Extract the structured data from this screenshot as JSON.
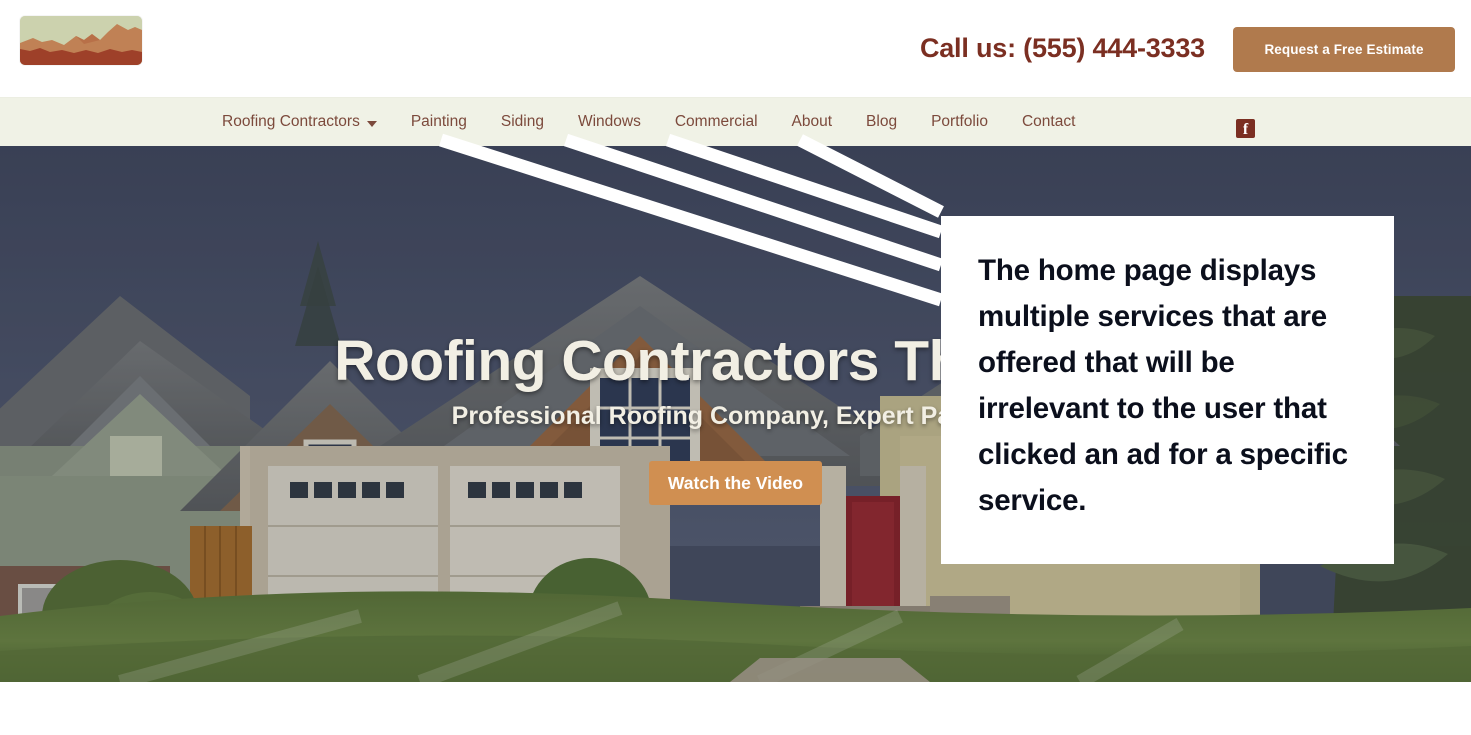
{
  "header": {
    "logo_alt": "mountain-landscape-logo",
    "phone_text": "Call us: (555) 444-3333",
    "estimate_button": "Request a Free Estimate"
  },
  "nav": {
    "items": [
      {
        "label": "Roofing Contractors",
        "has_dropdown": true
      },
      {
        "label": "Painting",
        "has_dropdown": false
      },
      {
        "label": "Siding",
        "has_dropdown": false
      },
      {
        "label": "Windows",
        "has_dropdown": false
      },
      {
        "label": "Commercial",
        "has_dropdown": false
      },
      {
        "label": "About",
        "has_dropdown": false
      },
      {
        "label": "Blog",
        "has_dropdown": false
      },
      {
        "label": "Portfolio",
        "has_dropdown": false
      },
      {
        "label": "Contact",
        "has_dropdown": false
      }
    ],
    "social": {
      "icon": "facebook-icon",
      "glyph": "f"
    }
  },
  "hero": {
    "title": "Roofing Contractors That Do t",
    "subtitle": "Professional Roofing Company, Expert Painters",
    "video_button": "Watch the Video",
    "image_alt": "suburban-craftsman-house-with-lawn"
  },
  "annotation": {
    "callout_text": "The home page displays multiple services that are offered that will be irrelevant to the user that clicked an ad for a specific service.",
    "pointer_count": 4,
    "pointer_targets": [
      "Painting",
      "Siding",
      "Windows",
      "Commercial"
    ],
    "line_color": "#ffffff",
    "box_background": "#ffffff",
    "box_text_color": "#0b0f1c"
  },
  "colors": {
    "brand_dark_red": "#7b2f22",
    "brand_tan": "#b07a4d",
    "nav_background": "#f0f2e6",
    "nav_link": "#7c4a3c",
    "hero_button": "#d08f51",
    "hero_text": "#f2efe4",
    "page_background": "#ffffff"
  }
}
